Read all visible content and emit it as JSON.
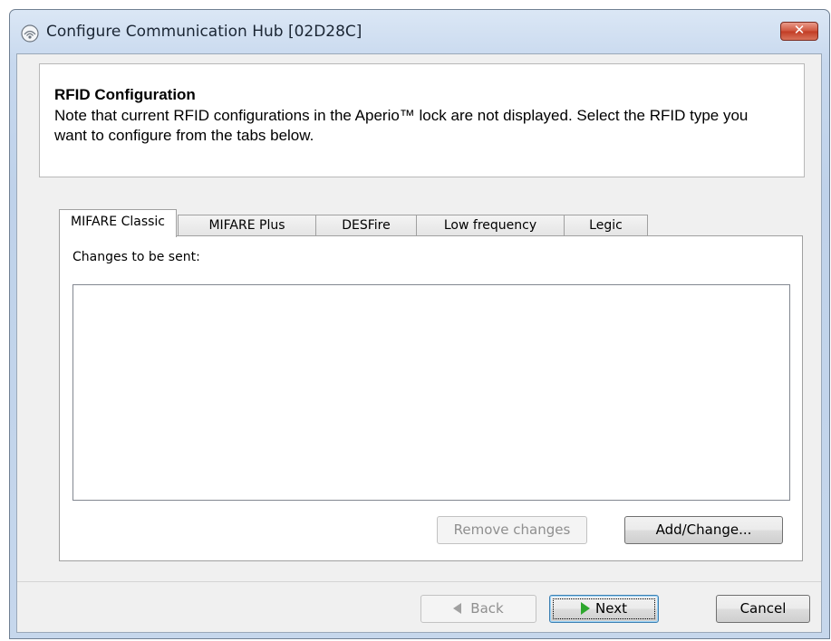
{
  "window": {
    "title": "Configure Communication Hub [02D28C]",
    "close_label": "✕"
  },
  "header": {
    "title": "RFID Configuration",
    "description": "Note that current RFID configurations in the Aperio™ lock are not displayed. Select the RFID type you want to configure from the tabs below."
  },
  "tabs": [
    {
      "label": "MIFARE Classic",
      "active": true
    },
    {
      "label": "MIFARE Plus",
      "active": false
    },
    {
      "label": "DESFire",
      "active": false
    },
    {
      "label": "Low frequency",
      "active": false
    },
    {
      "label": "Legic",
      "active": false
    }
  ],
  "panel": {
    "changes_label": "Changes to be sent:",
    "changes_items": [],
    "remove_label": "Remove changes",
    "add_label": "Add/Change..."
  },
  "footer": {
    "back_label": "Back",
    "next_label": "Next",
    "cancel_label": "Cancel"
  },
  "icons": {
    "app": "communication-hub-icon",
    "close": "close-icon",
    "back": "back-arrow-icon",
    "next": "next-arrow-icon"
  },
  "colors": {
    "close_button": "#c94a33",
    "next_arrow": "#2ea72e",
    "focus_border": "#3c7fb1"
  }
}
